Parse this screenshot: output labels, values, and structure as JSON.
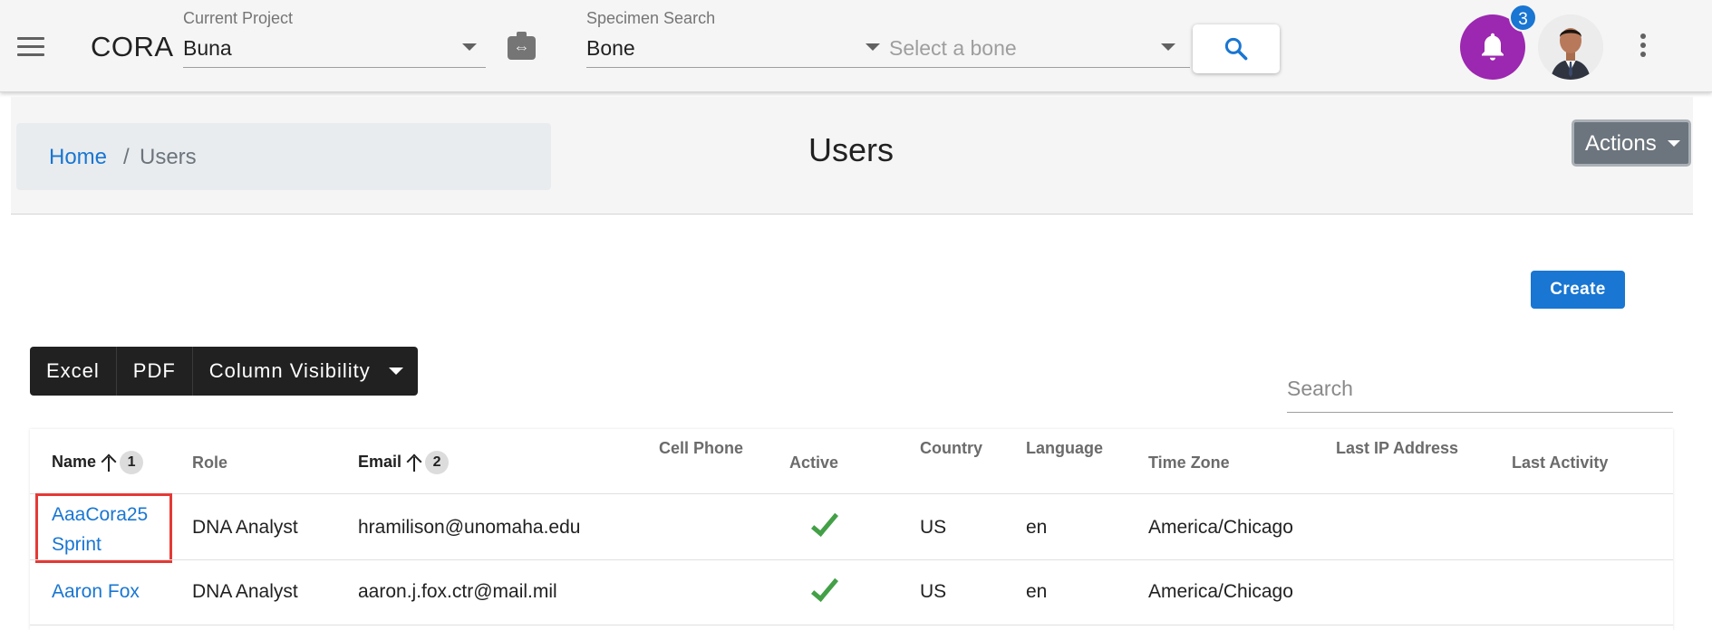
{
  "app": {
    "brand": "CORA"
  },
  "topbar": {
    "project_label": "Current Project",
    "project_value": "Buna",
    "specimen_label": "Specimen Search",
    "specimen_value": "Bone",
    "bone_placeholder": "Select a bone",
    "notification_count": "3"
  },
  "header": {
    "breadcrumb_home": "Home",
    "breadcrumb_separator": "/",
    "breadcrumb_current": "Users",
    "title": "Users",
    "actions_label": "Actions"
  },
  "toolbar": {
    "create_label": "Create",
    "excel_label": "Excel",
    "pdf_label": "PDF",
    "column_visibility_label": "Column Visibility",
    "search_placeholder": "Search"
  },
  "table": {
    "columns": {
      "name": "Name",
      "name_sort": "1",
      "role": "Role",
      "email": "Email",
      "email_sort": "2",
      "cell_phone": "Cell Phone",
      "active": "Active",
      "country": "Country",
      "language": "Language",
      "time_zone": "Time Zone",
      "last_ip": "Last IP Address",
      "last_activity": "Last Activity"
    },
    "rows": [
      {
        "name_line1": "AaaCora25",
        "name_line2": "Sprint",
        "role": "DNA Analyst",
        "email": "hramilison@unomaha.edu",
        "active": true,
        "country": "US",
        "language": "en",
        "time_zone": "America/Chicago"
      },
      {
        "name": "Aaron Fox",
        "role": "DNA Analyst",
        "email": "aaron.j.fox.ctr@mail.mil",
        "active": true,
        "country": "US",
        "language": "en",
        "time_zone": "America/Chicago"
      }
    ]
  },
  "colors": {
    "accent": "#1976d2",
    "notification": "#9c27b0",
    "active_check": "#43a047",
    "highlight": "#e53935"
  }
}
